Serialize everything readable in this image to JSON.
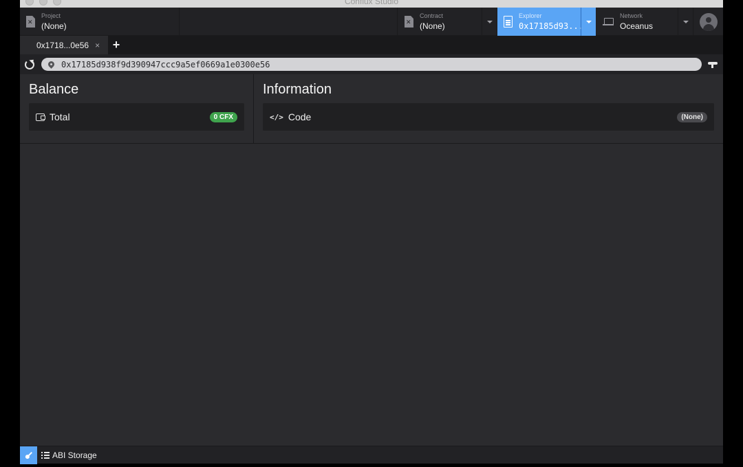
{
  "window": {
    "title": "Conflux Studio"
  },
  "header": {
    "project": {
      "label": "Project",
      "value": "(None)"
    },
    "contract": {
      "label": "Contract",
      "value": "(None)"
    },
    "explorer": {
      "label": "Explorer",
      "value": "0x17185d93..."
    },
    "network": {
      "label": "Network",
      "value": "Oceanus"
    }
  },
  "tabs": [
    {
      "label": "0x1718...0e56",
      "close": "×"
    }
  ],
  "tab_add": "+",
  "address": {
    "value": "0x17185d938f9d390947ccc9a5ef0669a1e0300e56"
  },
  "balance": {
    "title": "Balance",
    "total_label": "Total",
    "total_value": "0 CFX"
  },
  "information": {
    "title": "Information",
    "code_label": "Code",
    "code_value": "(None)"
  },
  "bottombar": {
    "abi_storage_label": "ABI Storage"
  },
  "colors": {
    "accent": "#5aa5f5",
    "badge_green": "#3fa34d",
    "background": "#2b2b2e"
  },
  "icons": [
    "file-icon",
    "document-icon",
    "laptop-icon",
    "avatar-icon",
    "refresh-icon",
    "location-pin-icon",
    "faucet-icon",
    "wallet-icon",
    "code-icon",
    "key-icon",
    "list-icon",
    "close-icon",
    "plus-icon",
    "chevron-down-icon"
  ]
}
